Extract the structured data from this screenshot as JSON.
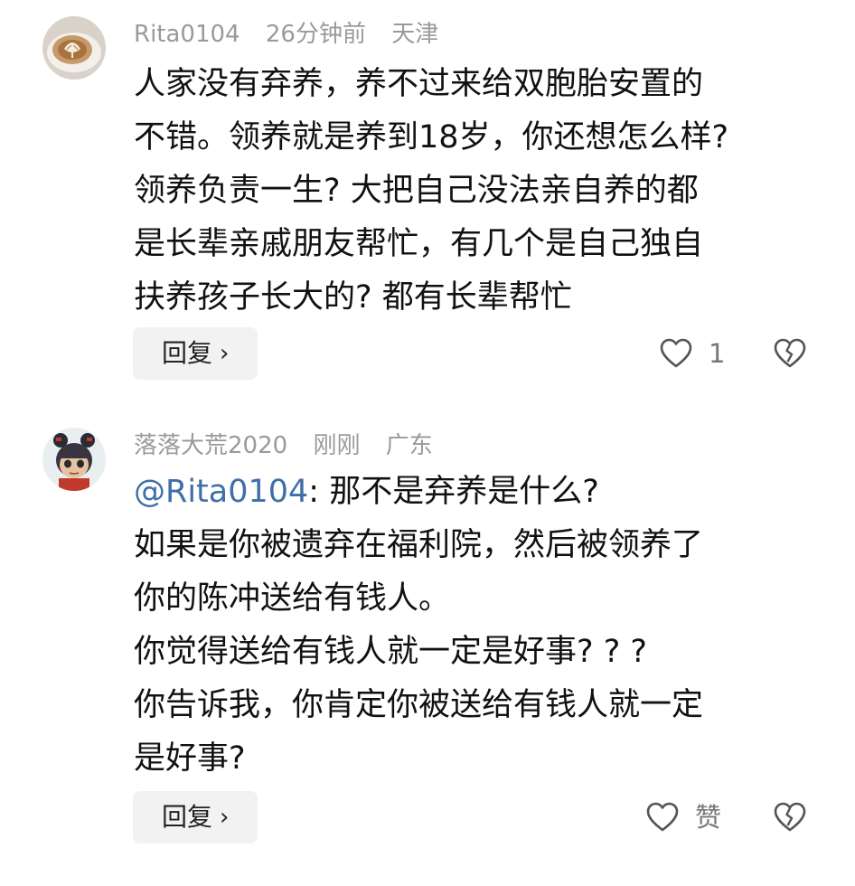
{
  "comments": [
    {
      "username": "Rita0104",
      "time": "26分钟前",
      "location": "天津",
      "avatar_icon": "latte-art-avatar",
      "lines": [
        "人家没有弃养，养不过来给双胞胎安置的",
        "不错。领养就是养到18岁，你还想怎么样?",
        "领养负责一生? 大把自己没法亲自养的都",
        "是长辈亲戚朋友帮忙，有几个是自己独自",
        "扶养孩子长大的? 都有长辈帮忙"
      ],
      "reply_label": "回复",
      "like_count": "1"
    },
    {
      "username": "落落大荒2020",
      "time": "刚刚",
      "location": "广东",
      "avatar_icon": "cartoon-girl-avatar",
      "mention": "@Rita0104",
      "first_line_rest": ": 那不是弃养是什么?",
      "lines": [
        "如果是你被遗弃在福利院，然后被领养了",
        "你的陈冲送给有钱人。",
        "你觉得送给有钱人就一定是好事? ? ?",
        "你告诉我，你肯定你被送给有钱人就一定",
        "是好事?"
      ],
      "reply_label": "回复",
      "like_label": "赞"
    }
  ],
  "colors": {
    "meta": "#9a9a9a",
    "mention": "#3f6fa6",
    "reply_bg": "#f2f2f2"
  }
}
